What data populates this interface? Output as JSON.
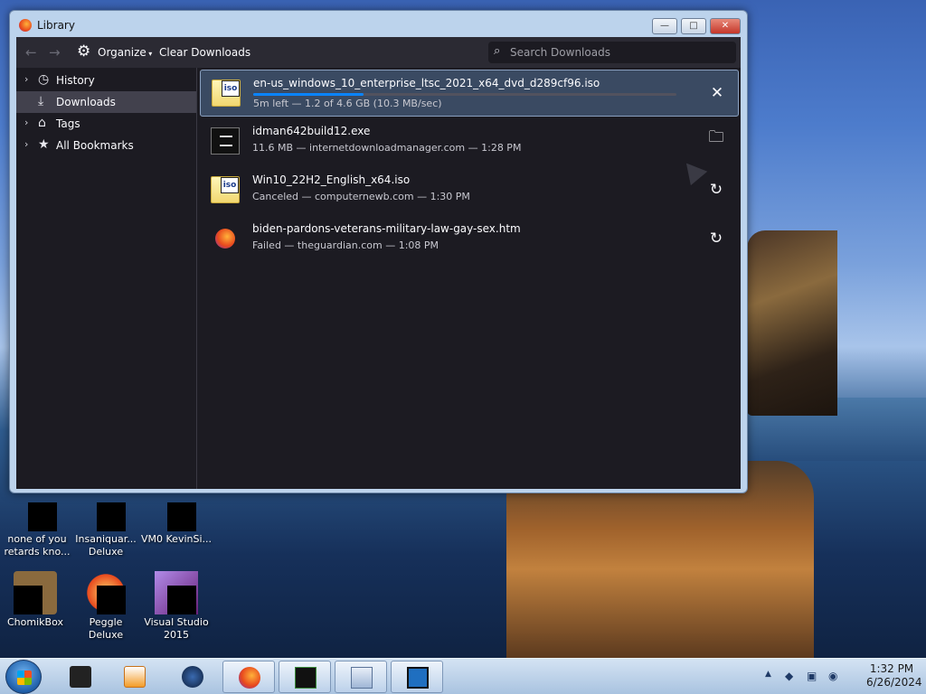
{
  "window": {
    "title": "Library",
    "minimize": "—",
    "maximize": "□",
    "close": "✕"
  },
  "toolbar": {
    "back_icon": "arrow-left-icon",
    "forward_icon": "arrow-right-icon",
    "organize_label": "Organize",
    "clear_label": "Clear Downloads",
    "search_placeholder": "Search Downloads"
  },
  "sidebar": {
    "items": [
      {
        "label": "History",
        "icon": "clock-icon",
        "expandable": true,
        "selected": false
      },
      {
        "label": "Downloads",
        "icon": "download-icon",
        "expandable": false,
        "selected": true
      },
      {
        "label": "Tags",
        "icon": "tag-icon",
        "expandable": true,
        "selected": false
      },
      {
        "label": "All Bookmarks",
        "icon": "star-icon",
        "expandable": true,
        "selected": false
      }
    ]
  },
  "downloads": [
    {
      "name": "en-us_windows_10_enterprise_ltsc_2021_x64_dvd_d289cf96.iso",
      "status": "5m left — 1.2 of 4.6 GB (10.3 MB/sec)",
      "progress": 0.26,
      "type": "iso",
      "action": "cancel-icon",
      "selected": true
    },
    {
      "name": "idman642build12.exe",
      "status": "11.6 MB — internetdownloadmanager.com — 1:28 PM",
      "type": "exe",
      "action": "folder-icon",
      "selected": false
    },
    {
      "name": "Win10_22H2_English_x64.iso",
      "status": "Canceled — computernewb.com — 1:30 PM",
      "type": "iso",
      "action": "retry-icon",
      "selected": false
    },
    {
      "name": "biden-pardons-veterans-military-law-gay-sex.htm",
      "status": "Failed — theguardian.com — 1:08 PM",
      "type": "htm",
      "action": "retry-icon",
      "selected": false
    }
  ],
  "desktop_icons": [
    {
      "label": "none of you retards kno..."
    },
    {
      "label": "Insaniquar... Deluxe"
    },
    {
      "label": "VM0 KevinSi..."
    },
    {
      "label": "ChomikBox"
    },
    {
      "label": "Peggle Deluxe"
    },
    {
      "label": "Visual Studio 2015"
    }
  ],
  "taskbar": {
    "time": "1:32 PM",
    "date": "6/26/2024"
  },
  "colors": {
    "accent": "#0a84ff",
    "panel": "#1c1b22",
    "toolbar": "#2b2a33"
  }
}
